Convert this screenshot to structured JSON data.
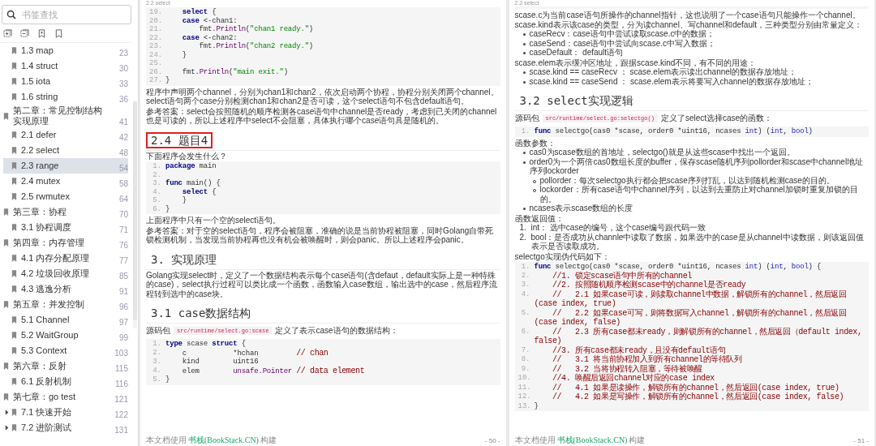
{
  "sidebar": {
    "search": {
      "placeholder": "书签查找"
    },
    "outline": {
      "continued": [
        {
          "label": "1.3 map",
          "page": "23",
          "selected": false
        },
        {
          "label": "1.4 struct",
          "page": "30",
          "selected": false
        },
        {
          "label": "1.5 iota",
          "page": "33",
          "selected": false
        },
        {
          "label": "1.6 string",
          "page": "36",
          "selected": false
        }
      ],
      "chapters": [
        {
          "label": "第二章：常见控制结构实现原理",
          "page": "41",
          "selected": false,
          "children": [
            {
              "label": "2.1 defer",
              "page": "42",
              "selected": false
            },
            {
              "label": "2.2 select",
              "page": "48",
              "selected": false
            },
            {
              "label": "2.3 range",
              "page": "54",
              "selected": true
            },
            {
              "label": "2.4 mutex",
              "page": "58",
              "selected": false
            },
            {
              "label": "2.5 rwmutex",
              "page": "64",
              "selected": false
            }
          ]
        },
        {
          "label": "第三章：协程",
          "page": "70",
          "selected": false,
          "children": [
            {
              "label": "3.1 协程调度",
              "page": "71",
              "selected": false
            }
          ]
        },
        {
          "label": "第四章：内存管理",
          "page": "76",
          "selected": false,
          "children": [
            {
              "label": "4.1 内存分配原理",
              "page": "77",
              "selected": false
            },
            {
              "label": "4.2 垃圾回收原理",
              "page": "85",
              "selected": false
            },
            {
              "label": "4.3 逃逸分析",
              "page": "91",
              "selected": false
            }
          ]
        },
        {
          "label": "第五章：并发控制",
          "page": "96",
          "selected": false,
          "children": [
            {
              "label": "5.1 Channel",
              "page": "97",
              "selected": false
            },
            {
              "label": "5.2 WaitGroup",
              "page": "99",
              "selected": false
            },
            {
              "label": "5.3 Context",
              "page": "103",
              "selected": false
            }
          ]
        },
        {
          "label": "第六章：反射",
          "page": "115",
          "selected": false,
          "children": [
            {
              "label": "6.1 反射机制",
              "page": "116",
              "selected": false
            }
          ]
        },
        {
          "label": "第七章：go test",
          "page": "121",
          "selected": false,
          "children": [
            {
              "label": "7.1 快速开始",
              "page": "122",
              "selected": false,
              "expanded": false
            },
            {
              "label": "7.2 进阶测试",
              "page": "131",
              "selected": false,
              "expanded": false
            }
          ]
        }
      ]
    }
  },
  "pages": [
    {
      "running_head": "2.2 select",
      "blocks": [
        {
          "kind": "code",
          "lines": [
            {
              "num": "19.",
              "parts": [
                {
                  "kind": "kw",
                  "text": "    select"
                },
                {
                  "kind": "plain",
                  "text": " {"
                }
              ]
            },
            {
              "num": "20.",
              "parts": [
                {
                  "kind": "kw",
                  "text": "    case"
                },
                {
                  "kind": "plain",
                  "text": " <-chan1:"
                }
              ]
            },
            {
              "num": "21.",
              "parts": [
                {
                  "kind": "plain",
                  "text": "        fmt."
                },
                {
                  "kind": "fn",
                  "text": "Println"
                },
                {
                  "kind": "plain",
                  "text": "("
                },
                {
                  "kind": "str",
                  "text": "\"chan1 ready.\""
                },
                {
                  "kind": "plain",
                  "text": ")"
                }
              ]
            },
            {
              "num": "22.",
              "parts": [
                {
                  "kind": "kw",
                  "text": "    case"
                },
                {
                  "kind": "plain",
                  "text": " <-chan2:"
                }
              ]
            },
            {
              "num": "23.",
              "parts": [
                {
                  "kind": "plain",
                  "text": "        fmt."
                },
                {
                  "kind": "fn",
                  "text": "Println"
                },
                {
                  "kind": "plain",
                  "text": "("
                },
                {
                  "kind": "str",
                  "text": "\"chan2 ready.\""
                },
                {
                  "kind": "plain",
                  "text": ")"
                }
              ]
            },
            {
              "num": "24.",
              "parts": [
                {
                  "kind": "plain",
                  "text": "    }"
                }
              ]
            },
            {
              "num": "25."
            },
            {
              "num": "26.",
              "parts": [
                {
                  "kind": "plain",
                  "text": "    fmt."
                },
                {
                  "kind": "fn",
                  "text": "Println"
                },
                {
                  "kind": "plain",
                  "text": "("
                },
                {
                  "kind": "str",
                  "text": "\"main exit.\""
                },
                {
                  "kind": "plain",
                  "text": ")"
                }
              ]
            },
            {
              "num": "27.",
              "parts": [
                {
                  "kind": "plain",
                  "text": "}"
                }
              ]
            }
          ]
        },
        {
          "kind": "para",
          "text": "程序中声明两个channel，分别为chan1和chan2，依次启动两个协程，协程分别关闭两个channel。select语句两个case分别检测chan1和chan2是否可读，这个select语句不包含default语句。"
        },
        {
          "kind": "para",
          "text": "参考答案：select会按照随机的顺序检测各case语句中channel是否ready，考虑到已关闭的channel也是可读的，所以上述程序中select不会阻塞，具体执行哪个case语句具是随机的。"
        },
        {
          "kind": "heading",
          "text": "2.4 题目4",
          "highlighted": true
        },
        {
          "kind": "para",
          "text": "下面程序会发生什么？"
        },
        {
          "kind": "code",
          "lines": [
            {
              "num": "1.",
              "parts": [
                {
                  "kind": "kw",
                  "text": "package"
                },
                {
                  "kind": "plain",
                  "text": " main"
                }
              ]
            },
            {
              "num": "2."
            },
            {
              "num": "3.",
              "parts": [
                {
                  "kind": "kw",
                  "text": "func"
                },
                {
                  "kind": "plain",
                  "text": " main() {"
                }
              ]
            },
            {
              "num": "4.",
              "parts": [
                {
                  "kind": "kw",
                  "text": "    select"
                },
                {
                  "kind": "plain",
                  "text": " {"
                }
              ]
            },
            {
              "num": "5.",
              "parts": [
                {
                  "kind": "plain",
                  "text": "    }"
                }
              ]
            },
            {
              "num": "6.",
              "parts": [
                {
                  "kind": "plain",
                  "text": "}"
                }
              ]
            }
          ]
        },
        {
          "kind": "para",
          "text": "上面程序中只有一个空的select语句。"
        },
        {
          "kind": "para",
          "text": "参考答案：对于空的select语句，程序会被阻塞，准确的说是当前协程被阻塞，同时Golang自带死锁检测机制，当发现当前协程再也没有机会被唤醒时，则会panic。所以上述程序会panic。"
        },
        {
          "kind": "heading",
          "text": "3. 实现原理",
          "highlighted": false
        },
        {
          "kind": "para",
          "text": "Golang实现select时，定义了一个数据结构表示每个case语句(含defaut，default实际上是一种特殊的case)，select执行过程可以类比成一个函数，函数输入case数组，输出选中的case，然后程序流程转到选中的case块。"
        },
        {
          "kind": "heading",
          "text": "3.1 case数据结构",
          "highlighted": false
        },
        {
          "kind": "source",
          "before": "源码包",
          "path": "src/runtime/select.go:scase",
          "after": "定义了表示case语句的数据结构："
        },
        {
          "kind": "code",
          "lines": [
            {
              "num": "1.",
              "parts": [
                {
                  "kind": "kw",
                  "text": "type"
                },
                {
                  "kind": "plain",
                  "text": " scase "
                },
                {
                  "kind": "kw",
                  "text": "struct"
                },
                {
                  "kind": "plain",
                  "text": " {"
                }
              ]
            },
            {
              "num": "2.",
              "parts": [
                {
                  "kind": "plain",
                  "text": "    c           *hchan         "
                },
                {
                  "kind": "com",
                  "text": "// chan"
                }
              ]
            },
            {
              "num": "3.",
              "parts": [
                {
                  "kind": "plain",
                  "text": "    kind        uint16"
                }
              ]
            },
            {
              "num": "4.",
              "parts": [
                {
                  "kind": "plain",
                  "text": "    elem        "
                },
                {
                  "kind": "fn",
                  "text": "unsafe.Pointer "
                },
                {
                  "kind": "com",
                  "text": "// data element"
                }
              ]
            },
            {
              "num": "5.",
              "parts": [
                {
                  "kind": "plain",
                  "text": "}"
                }
              ]
            }
          ]
        }
      ],
      "footer": {
        "prefix": "本文档使用",
        "link": "书栈(BookStack.CN)",
        "suffix": "构建"
      },
      "page_number": "- 50 -"
    },
    {
      "running_head": "2.2 select",
      "blocks": [
        {
          "kind": "code_tail"
        },
        {
          "kind": "para",
          "text": "scase.c为当前case语句所操作的channel指针，这也说明了一个case语句只能操作一个channel。scase.kind表示该case的类型，分为读channel、写channel和default，三种类型分别由常量定义："
        },
        {
          "kind": "bullets",
          "items": [
            {
              "text": "caseRecv：case语句中尝试读取scase.c中的数据；"
            },
            {
              "text": "caseSend：case语句中尝试向scase.c中写入数据；"
            },
            {
              "text": "caseDefault： default语句"
            }
          ]
        },
        {
          "kind": "para",
          "text": "scase.elem表示缓冲区地址，跟据scase.kind不同，有不同的用途："
        },
        {
          "kind": "bullets",
          "items": [
            {
              "text": "scase.kind == caseRecv ： scase.elem表示读出channel的数据存放地址；"
            },
            {
              "text": "scase.kind == caseSend ： scase.elem表示将要写入channel的数据存放地址；"
            }
          ]
        },
        {
          "kind": "heading",
          "text": "3.2 select实现逻辑",
          "highlighted": false
        },
        {
          "kind": "source",
          "before": "源码包",
          "path": "src/runtime/select.go:selectgo()",
          "after": "定义了select选择case的函数："
        },
        {
          "kind": "code",
          "lines": [
            {
              "num": "1.",
              "parts": [
                {
                  "kind": "kw",
                  "text": "func"
                },
                {
                  "kind": "plain",
                  "text": " selectgo(cas0 *scase, order0 *uint16, ncases "
                },
                {
                  "kind": "lit",
                  "text": "int"
                },
                {
                  "kind": "plain",
                  "text": ") ("
                },
                {
                  "kind": "lit",
                  "text": "int"
                },
                {
                  "kind": "plain",
                  "text": ", "
                },
                {
                  "kind": "lit",
                  "text": "bool"
                },
                {
                  "kind": "plain",
                  "text": ")"
                }
              ]
            }
          ]
        },
        {
          "kind": "para",
          "text": "函数参数："
        },
        {
          "kind": "bullets",
          "items": [
            {
              "text": "cas0为scase数组的首地址，selectgo()就是从这些scase中找出一个返回。"
            },
            {
              "text": "order0为一个两倍cas0数组长度的buffer，保存scase随机序列pollorder和scase中channel地址序列lockorder",
              "children": [
                {
                  "text": "pollorder：每次selectgo执行都会把scase序列打乱，以达到随机检测case的目的。"
                },
                {
                  "text": "lockorder：所有case语句中channel序列，以达到去重防止对channel加锁时重复加锁的目的。"
                }
              ]
            },
            {
              "text": "ncases表示scase数组的长度"
            }
          ]
        },
        {
          "kind": "para",
          "text": "函数返回值："
        },
        {
          "kind": "numbered",
          "items": [
            {
              "num": "1.",
              "text": "int： 选中case的编号，这个case编号跟代码一致"
            },
            {
              "num": "2.",
              "text": "bool：是否成功从channle中读取了数据，如果选中的case是从channel中读数据，则该返回值表示是否读取成功。"
            }
          ]
        },
        {
          "kind": "para",
          "text": "selectgo实现伪代码如下："
        },
        {
          "kind": "code",
          "lines": [
            {
              "num": "1.",
              "parts": [
                {
                  "kind": "kw",
                  "text": "func"
                },
                {
                  "kind": "plain",
                  "text": " selectgo(cas0 *scase, order0 *uint16, ncases "
                },
                {
                  "kind": "lit",
                  "text": "int"
                },
                {
                  "kind": "plain",
                  "text": ") ("
                },
                {
                  "kind": "lit",
                  "text": "int"
                },
                {
                  "kind": "plain",
                  "text": ", "
                },
                {
                  "kind": "lit",
                  "text": "bool"
                },
                {
                  "kind": "plain",
                  "text": ") {"
                }
              ]
            },
            {
              "num": "2.",
              "parts": [
                {
                  "kind": "com",
                  "text": "    //1. 锁定scase语句中所有的channel"
                }
              ]
            },
            {
              "num": "3.",
              "parts": [
                {
                  "kind": "com",
                  "text": "    //2. 按照随机顺序检测scase中的channel是否ready"
                }
              ]
            },
            {
              "num": "4.",
              "parts": [
                {
                  "kind": "com",
                  "text": "    //   2.1 如果case可读，则读取channel中数据，解锁所有的channel，然后返回(case index, true)"
                }
              ]
            },
            {
              "num": "5.",
              "parts": [
                {
                  "kind": "com",
                  "text": "    //   2.2 如果case可写，则将数据写入channel，解锁所有的channel，然后返回(case index, false)"
                }
              ]
            },
            {
              "num": "6.",
              "parts": [
                {
                  "kind": "com",
                  "text": "    //   2.3 所有case都未ready，则解锁所有的channel，然后返回（default index, false)"
                }
              ]
            },
            {
              "num": "7.",
              "parts": [
                {
                  "kind": "com",
                  "text": "    //3. 所有case都未ready，且没有default语句"
                }
              ]
            },
            {
              "num": "8.",
              "parts": [
                {
                  "kind": "com",
                  "text": "    //   3.1 将当前协程加入到所有channel的等待队列"
                }
              ]
            },
            {
              "num": "9.",
              "parts": [
                {
                  "kind": "com",
                  "text": "    //   3.2 当将协程转入阻塞，等待被唤醒"
                }
              ]
            },
            {
              "num": "10.",
              "parts": [
                {
                  "kind": "com",
                  "text": "    //4. 唤醒后返回channel对应的case index"
                }
              ]
            },
            {
              "num": "11.",
              "parts": [
                {
                  "kind": "com",
                  "text": "    //   4.1 如果是读操作，解锁所有的channel，然后返回(case index, true)"
                }
              ]
            },
            {
              "num": "12.",
              "parts": [
                {
                  "kind": "com",
                  "text": "    //   4.2 如果是写操作，解锁所有的channel，然后返回(case index, false)"
                }
              ]
            },
            {
              "num": "13.",
              "parts": [
                {
                  "kind": "plain",
                  "text": "}"
                }
              ]
            }
          ]
        }
      ],
      "footer": {
        "prefix": "本文档使用",
        "link": "书栈(BookStack.CN)",
        "suffix": "构建"
      },
      "page_number": "- 51 -"
    }
  ]
}
